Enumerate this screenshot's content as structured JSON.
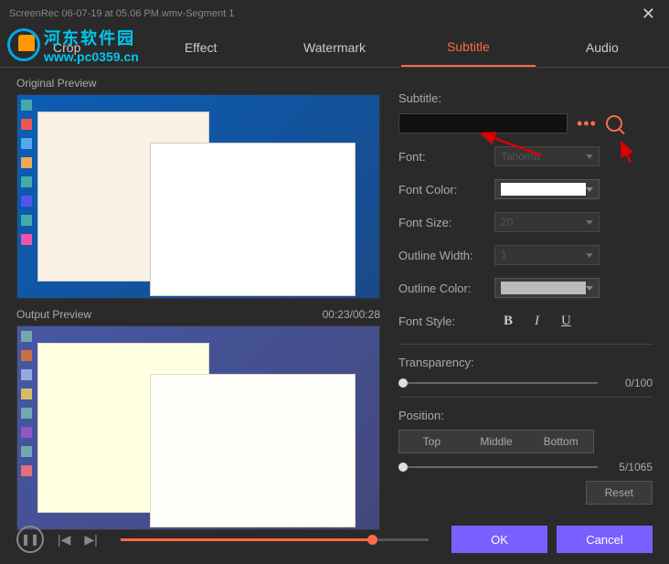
{
  "titlebar": {
    "title": "ScreenRec 06-07-19 at 05.06 PM.wmv-Segment 1"
  },
  "watermark": {
    "cn": "河东软件园",
    "url": "www.pc0359.cn"
  },
  "tabs": {
    "crop": "Crop",
    "effect": "Effect",
    "watermark": "Watermark",
    "subtitle": "Subtitle",
    "audio": "Audio"
  },
  "preview": {
    "original": "Original Preview",
    "output": "Output Preview",
    "time": "00:23/00:28"
  },
  "form": {
    "subtitle_label": "Subtitle:",
    "font_label": "Font:",
    "font_value": "Tahoma",
    "fontcolor_label": "Font Color:",
    "fontsize_label": "Font Size:",
    "fontsize_value": "20",
    "outlinewidth_label": "Outline Width:",
    "outlinewidth_value": "1",
    "outlinecolor_label": "Outline Color:",
    "fontstyle_label": "Font Style:",
    "bold": "B",
    "italic": "I",
    "underline": "U",
    "transparency_label": "Transparency:",
    "transparency_value": "0/100",
    "position_label": "Position:",
    "pos_top": "Top",
    "pos_middle": "Middle",
    "pos_bottom": "Bottom",
    "position_value": "5/1065",
    "reset": "Reset"
  },
  "actions": {
    "ok": "OK",
    "cancel": "Cancel"
  }
}
